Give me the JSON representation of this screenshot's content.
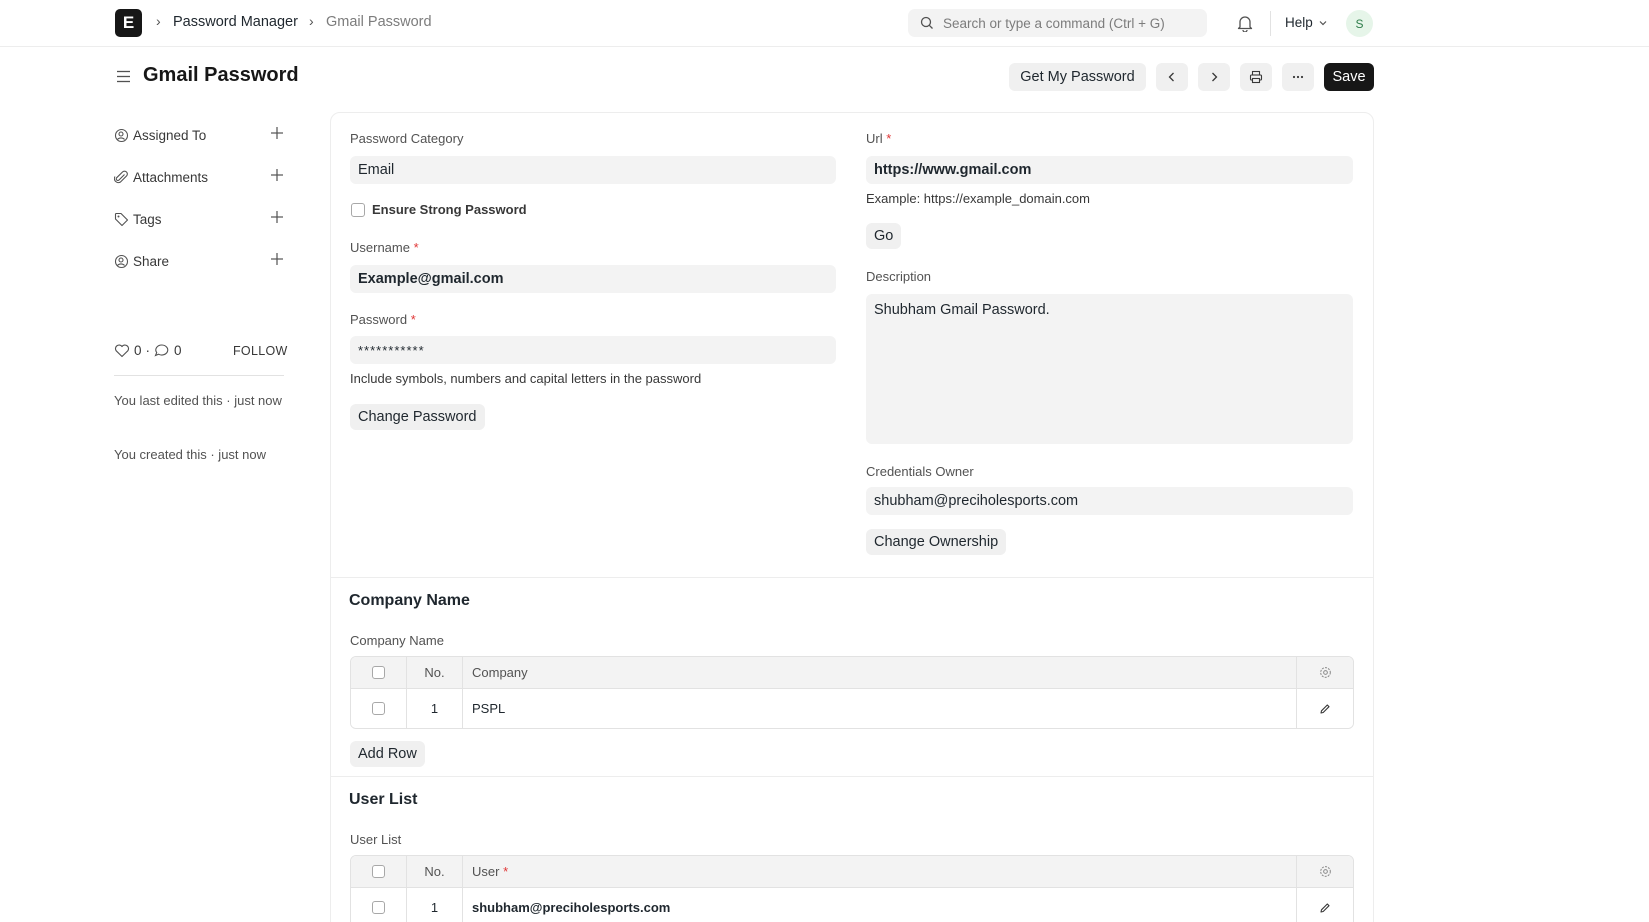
{
  "navbar": {
    "logo_letter": "E",
    "breadcrumbs": [
      "Password Manager",
      "Gmail Password"
    ],
    "search_placeholder": "Search or type a command (Ctrl + G)",
    "help_label": "Help",
    "avatar_initial": "S"
  },
  "page": {
    "title": "Gmail Password",
    "buttons": {
      "get_password": "Get My Password",
      "save": "Save"
    }
  },
  "sidebar": {
    "items": [
      {
        "label": "Assigned To",
        "icon": "user-assign-icon"
      },
      {
        "label": "Attachments",
        "icon": "paperclip-icon"
      },
      {
        "label": "Tags",
        "icon": "tag-icon"
      },
      {
        "label": "Share",
        "icon": "share-user-icon"
      }
    ],
    "likes": "0",
    "comments": "0",
    "follow_label": "FOLLOW",
    "notes": [
      "You last edited this · just now",
      "You created this · just now"
    ]
  },
  "form": {
    "password_category": {
      "label": "Password Category",
      "value": "Email"
    },
    "ensure_strong_password": {
      "label": "Ensure Strong Password",
      "checked": false
    },
    "username": {
      "label": "Username",
      "value": "Example@gmail.com"
    },
    "password": {
      "label": "Password",
      "value": "***********",
      "hint": "Include symbols, numbers and capital letters in the password"
    },
    "change_password_label": "Change Password",
    "url": {
      "label": "Url",
      "value": "https://www.gmail.com",
      "hint": "Example: https://example_domain.com"
    },
    "go_label": "Go",
    "description": {
      "label": "Description",
      "value": "Shubham Gmail Password."
    },
    "credentials_owner": {
      "label": "Credentials Owner",
      "value": "shubham@preciholesports.com"
    },
    "change_ownership_label": "Change Ownership"
  },
  "company_section": {
    "title": "Company Name",
    "field_label": "Company Name",
    "columns": {
      "no": "No.",
      "main": "Company"
    },
    "rows": [
      {
        "no": "1",
        "value": "PSPL"
      }
    ],
    "add_row_label": "Add Row"
  },
  "user_section": {
    "title": "User List",
    "field_label": "User List",
    "columns": {
      "no": "No.",
      "main": "User"
    },
    "rows": [
      {
        "no": "1",
        "value": "shubham@preciholesports.com"
      }
    ]
  },
  "colors": {
    "primary_button": "#171717",
    "field_bg": "#f3f3f3",
    "required": "#e03636"
  }
}
